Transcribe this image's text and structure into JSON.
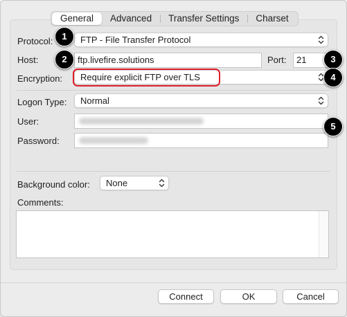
{
  "tabs": [
    {
      "label": "General",
      "active": true
    },
    {
      "label": "Advanced",
      "active": false
    },
    {
      "label": "Transfer Settings",
      "active": false
    },
    {
      "label": "Charset",
      "active": false
    }
  ],
  "form": {
    "protocol_label": "Protocol:",
    "protocol_value": "FTP - File Transfer Protocol",
    "host_label": "Host:",
    "host_value": "ftp.livefire.solutions",
    "port_label": "Port:",
    "port_value": "21",
    "encryption_label": "Encryption:",
    "encryption_value": "Require explicit FTP over TLS",
    "logon_type_label": "Logon Type:",
    "logon_type_value": "Normal",
    "user_label": "User:",
    "password_label": "Password:",
    "background_color_label": "Background color:",
    "background_color_value": "None",
    "comments_label": "Comments:"
  },
  "buttons": {
    "connect": "Connect",
    "ok": "OK",
    "cancel": "Cancel"
  },
  "callouts": [
    "1",
    "2",
    "3",
    "4",
    "5"
  ],
  "colors": {
    "highlight": "#e0202a",
    "badge": "#000000"
  }
}
